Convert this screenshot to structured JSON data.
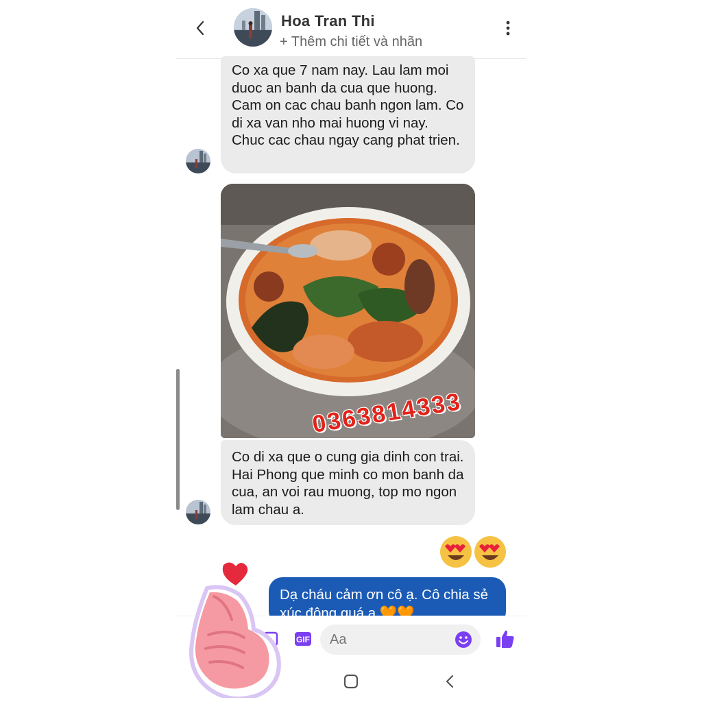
{
  "header": {
    "contact_name": "Hoa Tran Thi",
    "subtitle": "+ Thêm chi tiết và nhãn"
  },
  "messages": [
    {
      "direction": "incoming",
      "text": "Co xa que 7 nam nay. Lau lam moi duoc an banh da cua que huong. Cam on cac chau banh ngon lam. Co di xa van nho mai huong vi nay. Chuc cac chau ngay cang phat trien."
    },
    {
      "direction": "incoming",
      "type": "photo",
      "watermark": "0363814333"
    },
    {
      "direction": "incoming",
      "text": "Co di xa que o cung gia dinh con trai. Hai Phong que minh co mon banh da cua, an voi rau muong, top mo ngon lam chau a."
    },
    {
      "direction": "outgoing",
      "type": "reaction",
      "text": "😍😍"
    },
    {
      "direction": "outgoing",
      "text": "Dạ cháu cảm ơn cô ạ. Cô chia sẻ xúc động quá ạ 🧡🧡"
    }
  ],
  "composer": {
    "placeholder": "Aa"
  },
  "icons": {
    "back": "back-arrow-icon",
    "menu": "more-vertical-icon",
    "photo": "image-icon",
    "gif": "gif-icon",
    "emoji": "emoji-icon",
    "like": "thumbs-up-icon"
  },
  "colors": {
    "accent": "#7b3ff2",
    "outgoing_bubble": "#1b5bb5",
    "incoming_bubble": "#ebebeb",
    "watermark": "#e2231a"
  }
}
